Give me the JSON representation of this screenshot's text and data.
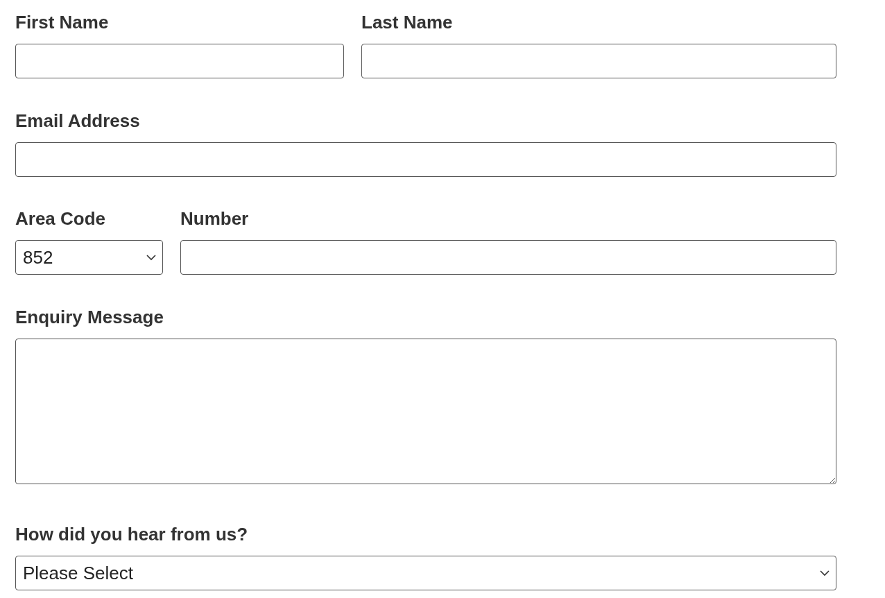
{
  "rows": [
    {
      "fields": [
        {
          "label": "First Name",
          "kind": "text"
        },
        {
          "label": "Last Name",
          "kind": "text"
        }
      ]
    },
    {
      "fields": [
        {
          "label": "Email Address",
          "kind": "text"
        }
      ]
    },
    {
      "fields": [
        {
          "label": "Area Code",
          "kind": "select",
          "value": "852"
        },
        {
          "label": "Number",
          "kind": "text"
        }
      ]
    },
    {
      "fields": [
        {
          "label": "Enquiry Message",
          "kind": "textarea"
        }
      ]
    },
    {
      "fields": [
        {
          "label": "How did you hear from us?",
          "kind": "select",
          "value": "Please Select"
        }
      ]
    }
  ]
}
